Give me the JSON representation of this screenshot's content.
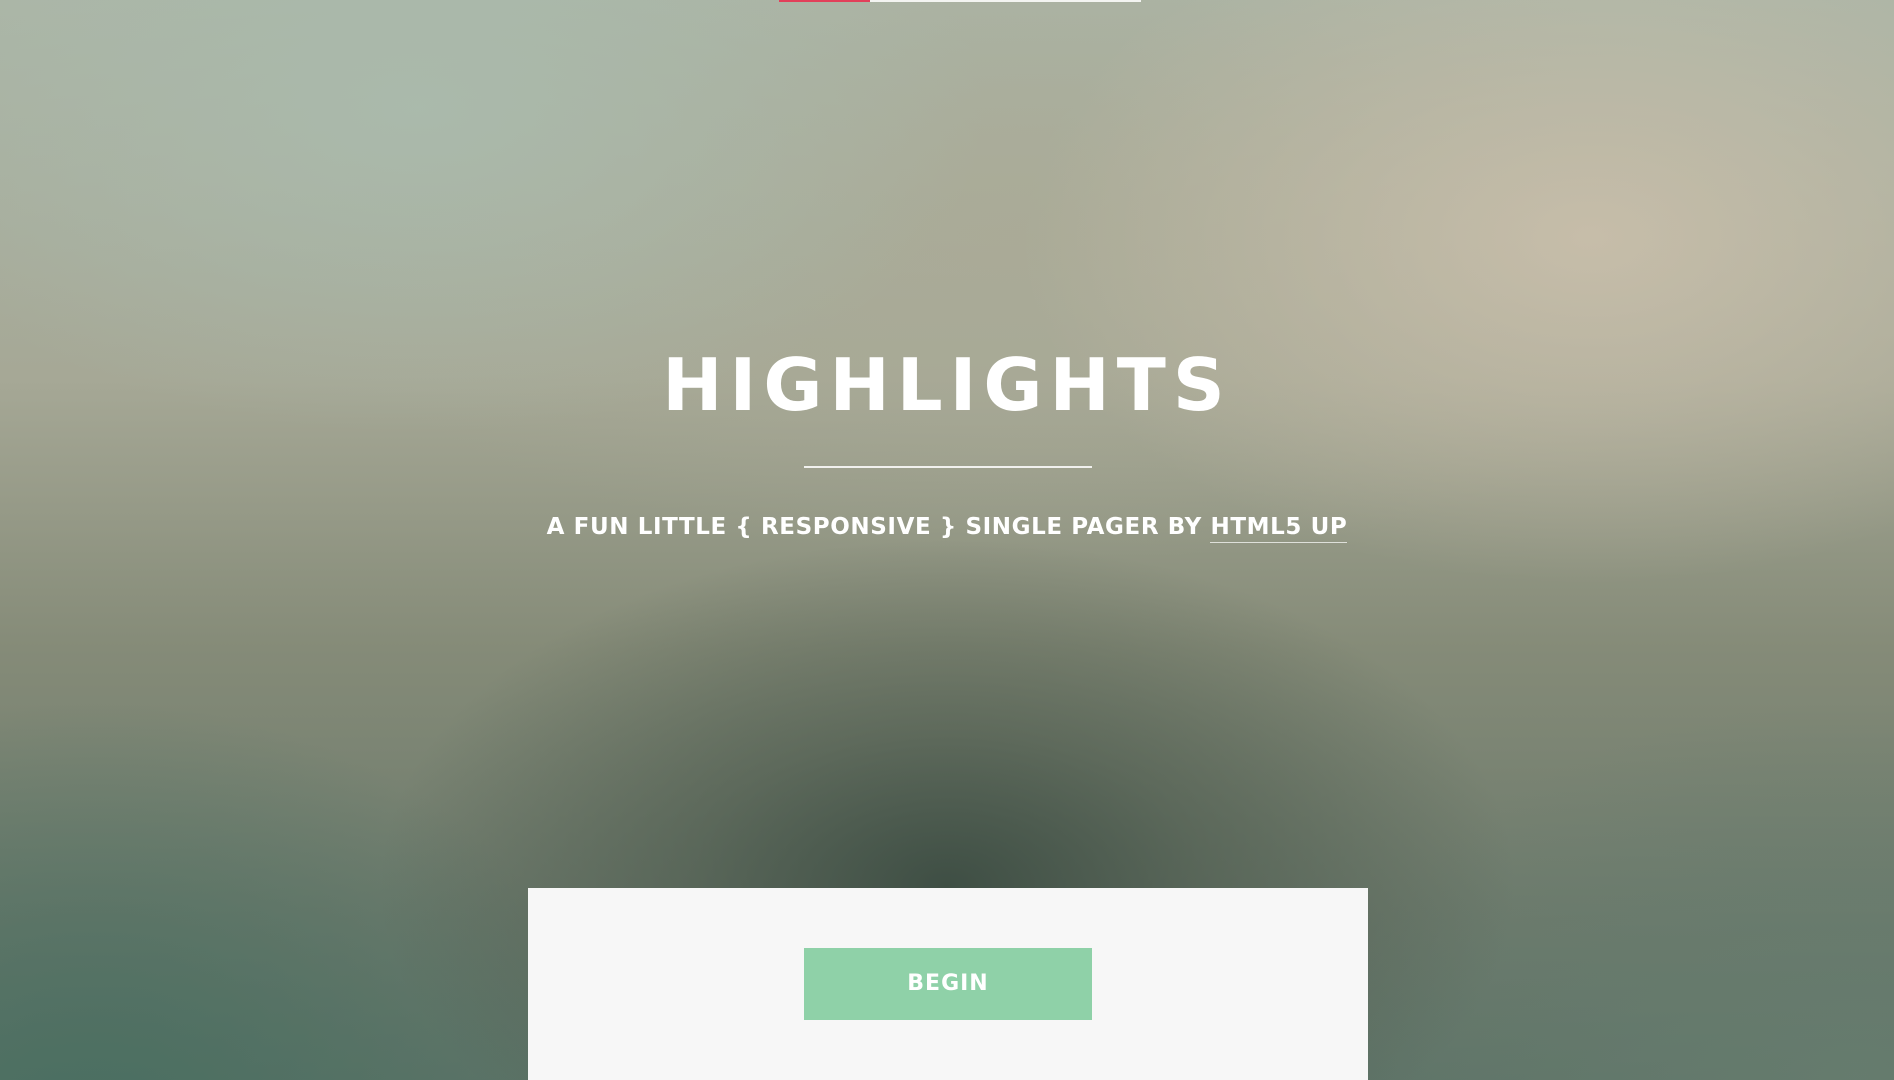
{
  "scroll_progress": 0.25,
  "hero": {
    "title": "HIGHLIGHTS",
    "subtitle_text": "A FUN LITTLE { RESPONSIVE } SINGLE PAGER BY ",
    "subtitle_link": "HTML5 UP"
  },
  "footer_panel": {
    "begin_label": "BEGIN"
  },
  "colors": {
    "accent": "#e2405a",
    "button": "#8fd1a8",
    "panel": "#f7f7f7"
  }
}
